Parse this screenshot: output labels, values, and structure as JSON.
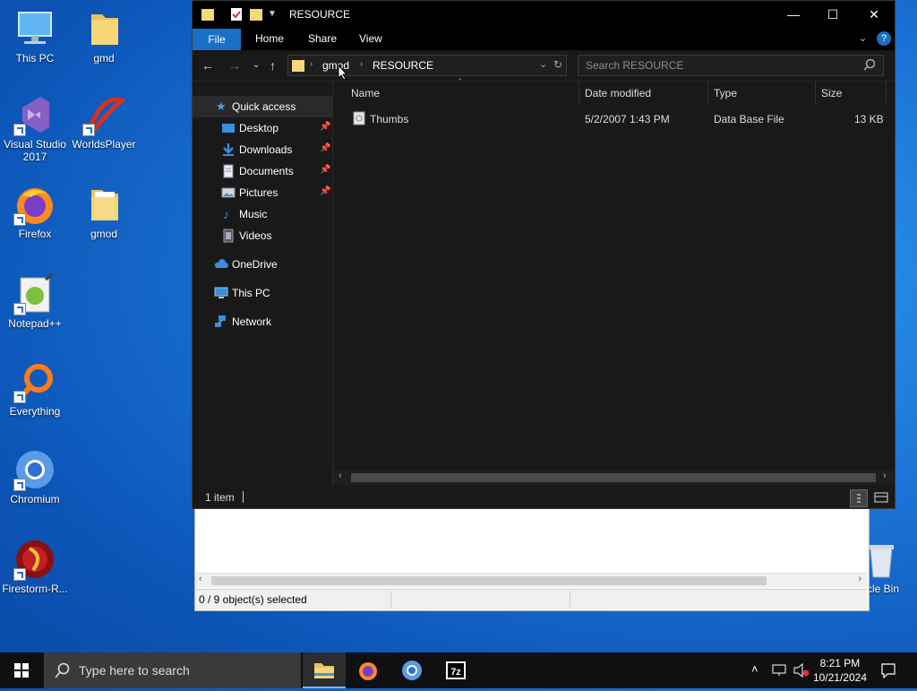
{
  "desktop": {
    "icons": [
      {
        "label": "This PC"
      },
      {
        "label": "gmd"
      },
      {
        "label": "Visual Studio 2017"
      },
      {
        "label": "WorldsPlayer"
      },
      {
        "label": "Firefox"
      },
      {
        "label": "gmod"
      },
      {
        "label": "Notepad++"
      },
      {
        "label": "Everything"
      },
      {
        "label": "Chromium"
      },
      {
        "label": "Firestorm-R..."
      },
      {
        "label": "cle Bin"
      }
    ]
  },
  "back_window": {
    "status": "0 / 9 object(s) selected"
  },
  "explorer": {
    "title": "RESOURCE",
    "ribbon_tabs": [
      "File",
      "Home",
      "Share",
      "View"
    ],
    "breadcrumb": [
      "gmod",
      "RESOURCE"
    ],
    "search_placeholder": "Search RESOURCE",
    "nav": {
      "quick_access": "Quick access",
      "items": [
        "Desktop",
        "Downloads",
        "Documents",
        "Pictures",
        "Music",
        "Videos"
      ],
      "onedrive": "OneDrive",
      "thispc": "This PC",
      "network": "Network"
    },
    "columns": [
      "Name",
      "Date modified",
      "Type",
      "Size"
    ],
    "rows": [
      {
        "name": "Thumbs",
        "date": "5/2/2007 1:43 PM",
        "type": "Data Base File",
        "size": "13 KB"
      }
    ],
    "status": "1 item"
  },
  "taskbar": {
    "search_placeholder": "Type here to search",
    "time": "8:21 PM",
    "date": "10/21/2024"
  },
  "colors": {
    "accent": "#1a6fc7",
    "explorer_bg": "#191919",
    "titlebar": "#000000"
  }
}
